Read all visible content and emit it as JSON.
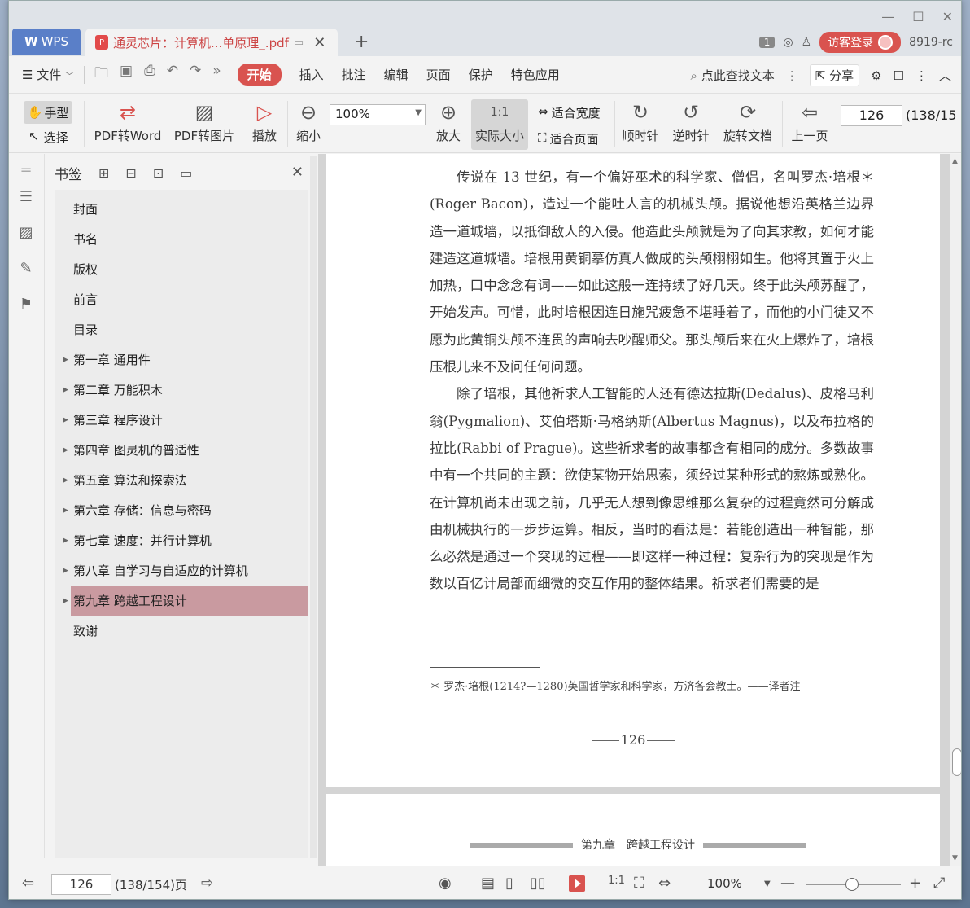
{
  "window": {
    "controls": [
      "—",
      "☐",
      "✕"
    ]
  },
  "tabs": {
    "wps_label": "WPS",
    "doc_title": "通灵芯片：计算机...单原理_.pdf",
    "add": "+"
  },
  "titlebar_right": {
    "badge": "1",
    "login_label": "访客登录",
    "user_text": "8919-rc"
  },
  "menu": {
    "file_label": "文件",
    "items": [
      "开始",
      "插入",
      "批注",
      "编辑",
      "页面",
      "保护",
      "特色应用"
    ],
    "search_label": "点此查找文本",
    "share_label": "分享"
  },
  "toolbar": {
    "hand_label": "手型",
    "select_label": "选择",
    "pdf_to_word": "PDF转Word",
    "pdf_to_image": "PDF转图片",
    "play": "播放",
    "zoom_out": "缩小",
    "zoom_value": "100%",
    "zoom_in": "放大",
    "actual_size": "实际大小",
    "fit_width": "适合宽度",
    "fit_page": "适合页面",
    "clockwise": "顺时针",
    "counter_clockwise": "逆时针",
    "rotate_doc": "旋转文档",
    "prev_page": "上一页",
    "page_value": "126",
    "page_total": "(138/15"
  },
  "bookmarks": {
    "title": "书签",
    "items": [
      {
        "label": "封面",
        "expandable": false
      },
      {
        "label": "书名",
        "expandable": false
      },
      {
        "label": "版权",
        "expandable": false
      },
      {
        "label": "前言",
        "expandable": false
      },
      {
        "label": "目录",
        "expandable": false
      },
      {
        "label": "第一章  通用件",
        "expandable": true
      },
      {
        "label": "第二章  万能积木",
        "expandable": true
      },
      {
        "label": "第三章  程序设计",
        "expandable": true
      },
      {
        "label": "第四章  图灵机的普适性",
        "expandable": true
      },
      {
        "label": "第五章  算法和探索法",
        "expandable": true
      },
      {
        "label": "第六章  存储：信息与密码",
        "expandable": true
      },
      {
        "label": "第七章  速度：并行计算机",
        "expandable": true
      },
      {
        "label": "第八章  自学习与自适应的计算机",
        "expandable": true
      },
      {
        "label": "第九章  跨越工程设计",
        "expandable": true,
        "selected": true
      },
      {
        "label": "致谢",
        "expandable": false
      }
    ]
  },
  "document": {
    "paragraphs": [
      "传说在 13 世纪，有一个偏好巫术的科学家、僧侣，名叫罗杰·培根＊(Roger Bacon)，造过一个能吐人言的机械头颅。据说他想沿英格兰边界造一道城墙，以抵御敌人的入侵。他造此头颅就是为了向其求教，如何才能建造这道城墙。培根用黄铜摹仿真人做成的头颅栩栩如生。他将其置于火上加热，口中念念有词——如此这般一连持续了好几天。终于此头颅苏醒了，开始发声。可惜，此时培根因连日施咒疲惫不堪睡着了，而他的小门徒又不愿为此黄铜头颅不连贯的声响去吵醒师父。那头颅后来在火上爆炸了，培根压根儿来不及问任何问题。",
      "除了培根，其他祈求人工智能的人还有德达拉斯(Dedalus)、皮格马利翁(Pygmalion)、艾伯塔斯·马格纳斯(Albertus Magnus)，以及布拉格的拉比(Rabbi of Prague)。这些祈求者的故事都含有相同的成分。多数故事中有一个共同的主题：欲使某物开始思索，须经过某种形式的熬炼或熟化。在计算机尚未出现之前，几乎无人想到像思维那么复杂的过程竟然可分解成由机械执行的一步步运算。相反，当时的看法是：若能创造出一种智能，那么必然是通过一个突现的过程——即这样一种过程：复杂行为的突现是作为数以百亿计局部而细微的交互作用的整体结果。祈求者们需要的是"
    ],
    "footnote": "＊  罗杰·培根(1214?—1280)英国哲学家和科学家，方济各会教士。——译者注",
    "page_number": "126",
    "next_page_header": "第九章　跨越工程设计"
  },
  "statusbar": {
    "page_value": "126",
    "page_total": "(138/154)页",
    "zoom_value": "100%"
  },
  "colors": {
    "accent": "#d9534f",
    "selected_bookmark": "#c99aa0",
    "wps_tab": "#5a7fc8"
  }
}
